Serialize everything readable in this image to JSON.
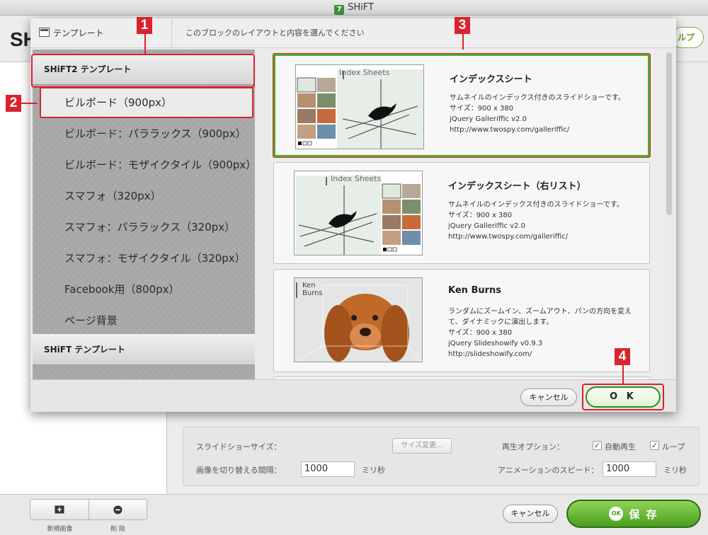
{
  "window": {
    "title": "SHiFT",
    "app_icon": "7"
  },
  "background": {
    "title": "SH",
    "help_button": "ルプ",
    "settings": {
      "slideshow_size_label": "スライドショーサイズ：",
      "change_size_button": "サイズ変更...",
      "playback_options_label": "再生オプション：",
      "autoplay_label": "自動再生",
      "autoplay_checked": true,
      "loop_label": "ループ",
      "loop_checked": true,
      "interval_label": "画像を切り替える間隔：",
      "interval_value": "1000",
      "interval_unit": "ミリ秒",
      "animation_speed_label": "アニメーションのスピード：",
      "animation_speed_value": "1000",
      "animation_speed_unit": "ミリ秒"
    },
    "bottom": {
      "new_image_label": "新規画像",
      "delete_label": "削 除",
      "cancel_button": "キャンセル",
      "save_button": "保 存",
      "save_icon_text": "OK"
    }
  },
  "dialog": {
    "header_label": "テンプレート",
    "instruction": "このブロックのレイアウトと内容を選んでください",
    "categories": [
      {
        "label": "SHiFT2 テンプレート"
      },
      {
        "label": "SHiFT テンプレート"
      }
    ],
    "items": [
      {
        "label": "ビルボード（900px）",
        "selected": true
      },
      {
        "label": "ビルボード：パララックス（900px）"
      },
      {
        "label": "ビルボード：モザイクタイル（900px）"
      },
      {
        "label": "スマフォ（320px）"
      },
      {
        "label": "スマフォ：パララックス（320px）"
      },
      {
        "label": "スマフォ：モザイクタイル（320px）"
      },
      {
        "label": "Facebook用（800px）"
      },
      {
        "label": "ページ背景"
      }
    ],
    "templates": [
      {
        "title": "インデックスシート",
        "thumb_caption": "Index Sheets",
        "desc": [
          "サムネイルのインデックス付きのスライドショーです。",
          "サイズ：900 x 380",
          "jQuery Galleriffic v2.0",
          "http://www.twospy.com/galleriffic/"
        ],
        "selected": true
      },
      {
        "title": "インデックスシート（右リスト）",
        "thumb_caption": "Index Sheets",
        "desc": [
          "サムネイルのインデックス付きのスライドショーです。",
          "サイズ：900 x 380",
          "jQuery Galleriffic v2.0",
          "http://www.twospy.com/galleriffic/"
        ],
        "selected": false
      },
      {
        "title": "Ken Burns",
        "thumb_caption_1": "Ken",
        "thumb_caption_2": "Burns",
        "desc": [
          "ランダムにズームイン、ズームアウト、パンの方向を変え",
          "て、ダイナミックに演出します。",
          "サイズ：900 x 380",
          "jQuery Slideshowify v0.9.3",
          "http://slideshowify.com/"
        ],
        "selected": false
      }
    ],
    "cancel_button": "キャンセル",
    "ok_button": "O K"
  },
  "annotations": [
    "1",
    "2",
    "3",
    "4"
  ],
  "colors": {
    "annotation_red": "#d9232d",
    "ok_green": "#2e8b1a",
    "selected_card_border": "#55a82d"
  }
}
